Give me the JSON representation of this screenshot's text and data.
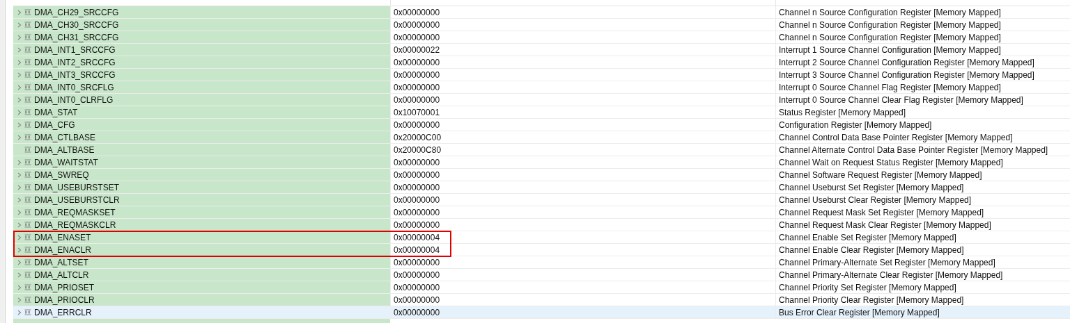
{
  "registers": [
    {
      "name": "DMA_CH29_SRCCFG",
      "value": "0x00000000",
      "description": "Channel n Source Configuration Register [Memory Mapped]",
      "expandable": true,
      "selected": false,
      "highlighted": false
    },
    {
      "name": "DMA_CH30_SRCCFG",
      "value": "0x00000000",
      "description": "Channel n Source Configuration Register [Memory Mapped]",
      "expandable": true,
      "selected": false,
      "highlighted": false
    },
    {
      "name": "DMA_CH31_SRCCFG",
      "value": "0x00000000",
      "description": "Channel n Source Configuration Register [Memory Mapped]",
      "expandable": true,
      "selected": false,
      "highlighted": false
    },
    {
      "name": "DMA_INT1_SRCCFG",
      "value": "0x00000022",
      "description": "Interrupt 1 Source Channel Configuration [Memory Mapped]",
      "expandable": true,
      "selected": false,
      "highlighted": false
    },
    {
      "name": "DMA_INT2_SRCCFG",
      "value": "0x00000000",
      "description": "Interrupt 2 Source Channel Configuration Register [Memory Mapped]",
      "expandable": true,
      "selected": false,
      "highlighted": false
    },
    {
      "name": "DMA_INT3_SRCCFG",
      "value": "0x00000000",
      "description": "Interrupt 3 Source Channel Configuration Register [Memory Mapped]",
      "expandable": true,
      "selected": false,
      "highlighted": false
    },
    {
      "name": "DMA_INT0_SRCFLG",
      "value": "0x00000000",
      "description": "Interrupt 0 Source Channel Flag Register [Memory Mapped]",
      "expandable": true,
      "selected": false,
      "highlighted": false
    },
    {
      "name": "DMA_INT0_CLRFLG",
      "value": "0x00000000",
      "description": "Interrupt 0 Source Channel Clear Flag Register [Memory Mapped]",
      "expandable": true,
      "selected": false,
      "highlighted": false
    },
    {
      "name": "DMA_STAT",
      "value": "0x10070001",
      "description": "Status Register [Memory Mapped]",
      "expandable": true,
      "selected": false,
      "highlighted": false
    },
    {
      "name": "DMA_CFG",
      "value": "0x00000000",
      "description": "Configuration Register [Memory Mapped]",
      "expandable": true,
      "selected": false,
      "highlighted": false
    },
    {
      "name": "DMA_CTLBASE",
      "value": "0x20000C00",
      "description": "Channel Control Data Base Pointer Register [Memory Mapped]",
      "expandable": true,
      "selected": false,
      "highlighted": false
    },
    {
      "name": "DMA_ALTBASE",
      "value": "0x20000C80",
      "description": "Channel Alternate Control Data Base Pointer Register [Memory Mapped]",
      "expandable": false,
      "selected": false,
      "highlighted": false
    },
    {
      "name": "DMA_WAITSTAT",
      "value": "0x00000000",
      "description": "Channel Wait on Request Status Register [Memory Mapped]",
      "expandable": true,
      "selected": false,
      "highlighted": false
    },
    {
      "name": "DMA_SWREQ",
      "value": "0x00000000",
      "description": "Channel Software Request Register [Memory Mapped]",
      "expandable": true,
      "selected": false,
      "highlighted": false
    },
    {
      "name": "DMA_USEBURSTSET",
      "value": "0x00000000",
      "description": "Channel Useburst Set Register [Memory Mapped]",
      "expandable": true,
      "selected": false,
      "highlighted": false
    },
    {
      "name": "DMA_USEBURSTCLR",
      "value": "0x00000000",
      "description": "Channel Useburst Clear Register [Memory Mapped]",
      "expandable": true,
      "selected": false,
      "highlighted": false
    },
    {
      "name": "DMA_REQMASKSET",
      "value": "0x00000000",
      "description": "Channel Request Mask Set Register [Memory Mapped]",
      "expandable": true,
      "selected": false,
      "highlighted": false
    },
    {
      "name": "DMA_REQMASKCLR",
      "value": "0x00000000",
      "description": "Channel Request Mask Clear Register [Memory Mapped]",
      "expandable": true,
      "selected": false,
      "highlighted": false
    },
    {
      "name": "DMA_ENASET",
      "value": "0x00000004",
      "description": "Channel Enable Set Register [Memory Mapped]",
      "expandable": true,
      "selected": false,
      "highlighted": true
    },
    {
      "name": "DMA_ENACLR",
      "value": "0x00000004",
      "description": "Channel Enable Clear Register [Memory Mapped]",
      "expandable": true,
      "selected": false,
      "highlighted": true
    },
    {
      "name": "DMA_ALTSET",
      "value": "0x00000000",
      "description": "Channel Primary-Alternate Set Register [Memory Mapped]",
      "expandable": true,
      "selected": false,
      "highlighted": false
    },
    {
      "name": "DMA_ALTCLR",
      "value": "0x00000000",
      "description": "Channel Primary-Alternate Clear Register [Memory Mapped]",
      "expandable": true,
      "selected": false,
      "highlighted": false
    },
    {
      "name": "DMA_PRIOSET",
      "value": "0x00000000",
      "description": "Channel Priority Set Register [Memory Mapped]",
      "expandable": true,
      "selected": false,
      "highlighted": false
    },
    {
      "name": "DMA_PRIOCLR",
      "value": "0x00000000",
      "description": "Channel Priority Clear Register [Memory Mapped]",
      "expandable": true,
      "selected": false,
      "highlighted": false
    },
    {
      "name": "DMA_ERRCLR",
      "value": "0x00000000",
      "description": "Bus Error Clear Register [Memory Mapped]",
      "expandable": true,
      "selected": true,
      "highlighted": false
    }
  ]
}
